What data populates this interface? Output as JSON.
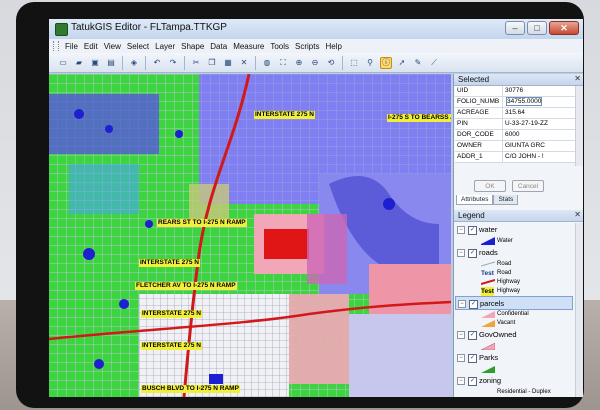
{
  "window": {
    "title": "TatukGIS Editor - FLTampa.TTKGP",
    "minimize": "–",
    "maximize": "□",
    "close": "✕"
  },
  "menu": [
    "File",
    "Edit",
    "View",
    "Select",
    "Layer",
    "Shape",
    "Data",
    "Measure",
    "Tools",
    "Scripts",
    "Help"
  ],
  "toolbar_icons": [
    "new-icon",
    "open-icon",
    "save-icon",
    "print-icon",
    "layers-icon",
    "undo-icon",
    "redo-icon",
    "cut-icon",
    "copy-icon",
    "paste-icon",
    "delete-icon",
    "globe-icon",
    "zoom-extent-icon",
    "zoom-in-icon",
    "zoom-out-icon",
    "refresh-icon",
    "select-icon",
    "search-icon",
    "identify-icon",
    "pointer-icon",
    "edit-icon",
    "measure-icon"
  ],
  "map": {
    "labels": [
      "INTERSTATE 275 N",
      "REARS ST TO I-275 N RAMP",
      "INTERSTATE 275 N",
      "FLETCHER AV TO I-275 N RAMP",
      "INTERSTATE 275 N",
      "INTERSTATE 275 N",
      "BUSCH BLVD TO I-275 N RAMP",
      "I-275 S TO BEARSS AV RAMP"
    ]
  },
  "selected": {
    "title": "Selected",
    "rows": [
      {
        "key": "UID",
        "value": "30776"
      },
      {
        "key": "FOLIO_NUMB",
        "value": "34755.0000"
      },
      {
        "key": "ACREAGE",
        "value": "315.64"
      },
      {
        "key": "PIN",
        "value": "U-33-27-19-ZZ"
      },
      {
        "key": "DOR_CODE",
        "value": "6000"
      },
      {
        "key": "OWNER",
        "value": "GIUNTA GRC"
      },
      {
        "key": "ADDR_1",
        "value": "C/O JOHN - !"
      }
    ],
    "ok": "OK",
    "cancel": "Cancel",
    "tabs": [
      "Attributes",
      "Stats"
    ]
  },
  "legend": {
    "title": "Legend",
    "groups": [
      {
        "name": "water",
        "items": [
          "Water"
        ]
      },
      {
        "name": "roads",
        "items": [
          "Road",
          "Road",
          "Highway",
          "Highway"
        ]
      },
      {
        "name": "parcels",
        "items": [
          "Confidential",
          "Vacant"
        ]
      },
      {
        "name": "GovOwned",
        "items": [
          ""
        ]
      },
      {
        "name": "Parks",
        "items": [
          ""
        ]
      },
      {
        "name": "zoning",
        "items": [
          "Residential - Duplex"
        ]
      }
    ],
    "symbol_text": "Test"
  },
  "colors": {
    "water": "#1d1fd0",
    "road": "#b7c3d2",
    "highway": "#d21818",
    "parcel_pink": "#f2a7b8",
    "parks": "#2e9d2a",
    "zoning": "#8d8df0"
  }
}
